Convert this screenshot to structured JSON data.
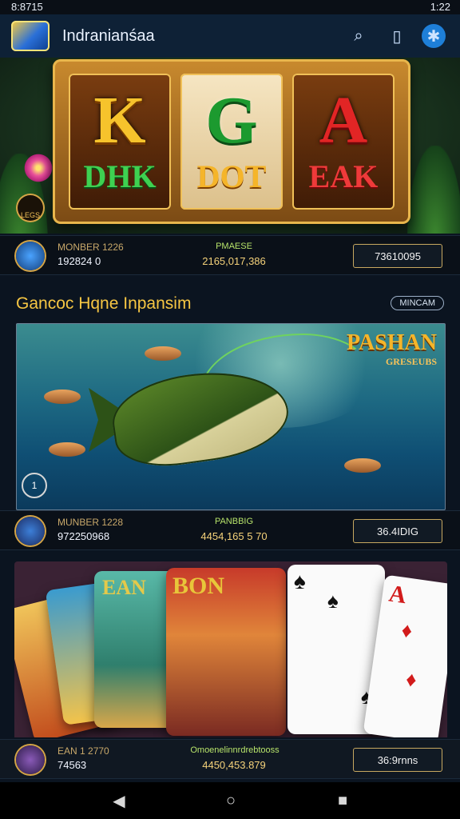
{
  "status_bar": {
    "time_left": "8:8715",
    "time_right": "1:22"
  },
  "app": {
    "title": "Indrаnianśaa",
    "accent": "#1e7fd8"
  },
  "icons": {
    "search": "search-icon",
    "document": "document-icon",
    "profile": "profile-icon"
  },
  "slot": {
    "reels": [
      {
        "big": "K",
        "small": "DHK"
      },
      {
        "big": "G",
        "small": "DOT"
      },
      {
        "big": "A",
        "small": "EAK"
      }
    ],
    "badge": "LEGS"
  },
  "info_bars": [
    {
      "line1": "MONBER 1226",
      "line2": "192824   0",
      "mid1": "PMAESE",
      "mid2": "2165,017,386",
      "button": "73610095"
    },
    {
      "line1": "MUNBER 1228",
      "line2": "972250968",
      "mid1": "PANBBIG",
      "mid2": "4454,165 5 70",
      "button": "36.4IDIG"
    },
    {
      "line1": "EAN 1 2770",
      "line2": "74563",
      "mid1": "Omoenelinnrdrebtooss",
      "mid2": "4450,453.879",
      "button": "36:9rnns"
    }
  ],
  "section": {
    "title": "Gancoc Hqne Inpansim",
    "pill": "MINCAM"
  },
  "fishing": {
    "title": "PASHAN",
    "subtitle": "GRESEUBS",
    "badge": "1"
  },
  "cards": [
    {
      "corner": ""
    },
    {
      "corner": ""
    },
    {
      "corner": "EAN"
    },
    {
      "corner": "BON"
    },
    {
      "corner": "♠"
    },
    {
      "corner": "A"
    }
  ],
  "nav": {
    "back": "◀",
    "home": "○",
    "recent": "■"
  }
}
